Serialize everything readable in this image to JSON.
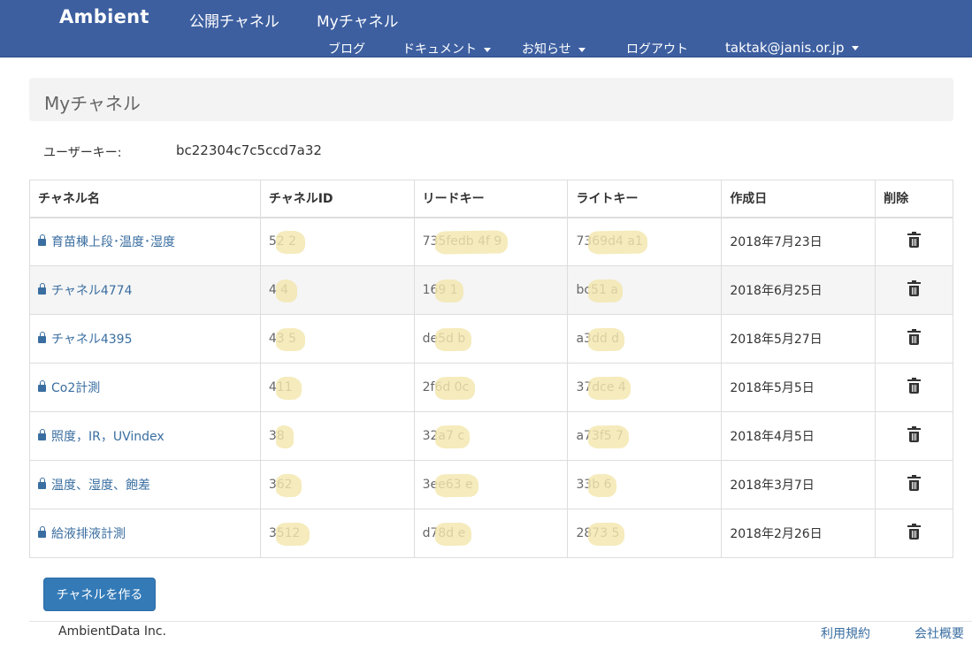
{
  "navbar": {
    "brand": "Ambient",
    "primary": [
      "公開チャネル",
      "Myチャネル"
    ],
    "secondary": {
      "blog": "ブログ",
      "docs": "ドキュメント",
      "news": "お知らせ",
      "logout": "ログアウト",
      "user": "taktak@janis.or.jp"
    }
  },
  "page": {
    "title": "Myチャネル",
    "user_key_label": "ユーザーキー:",
    "user_key_value": "bc22304c7c5ccd7a32"
  },
  "table": {
    "headers": [
      "チャネル名",
      "チャネルID",
      "リードキー",
      "ライトキー",
      "作成日",
      "削除"
    ],
    "rows": [
      {
        "name": "育苗棟上段･温度･湿度",
        "id": "52 2",
        "read_key": "735fedb   4f   9",
        "write_key": "7369d4   a1",
        "date": "2018年7月23日"
      },
      {
        "name": "チャネル4774",
        "id": "4  4",
        "read_key": "169   1",
        "write_key": "bc51   a",
        "date": "2018年6月25日"
      },
      {
        "name": "チャネル4395",
        "id": "43 5",
        "read_key": "de5d   b",
        "write_key": "a3dd   d",
        "date": "2018年5月27日"
      },
      {
        "name": "Co2計測",
        "id": "411",
        "read_key": "2f6d   0c",
        "write_key": "37dce   4",
        "date": "2018年5月5日"
      },
      {
        "name": "照度，IR，UVindex",
        "id": "38",
        "read_key": "32a7   c",
        "write_key": "a73f5   7",
        "date": "2018年4月5日"
      },
      {
        "name": "温度、湿度、飽差",
        "id": "362",
        "read_key": "3ee63   e",
        "write_key": "33b   6",
        "date": "2018年3月7日"
      },
      {
        "name": "給液排液計測",
        "id": "3512",
        "read_key": "d78d   e",
        "write_key": "2873   5",
        "date": "2018年2月26日"
      }
    ]
  },
  "actions": {
    "create_channel": "チャネルを作る"
  },
  "footer": {
    "company": "AmbientData Inc.",
    "terms": "利用規約",
    "about": "会社概要"
  }
}
